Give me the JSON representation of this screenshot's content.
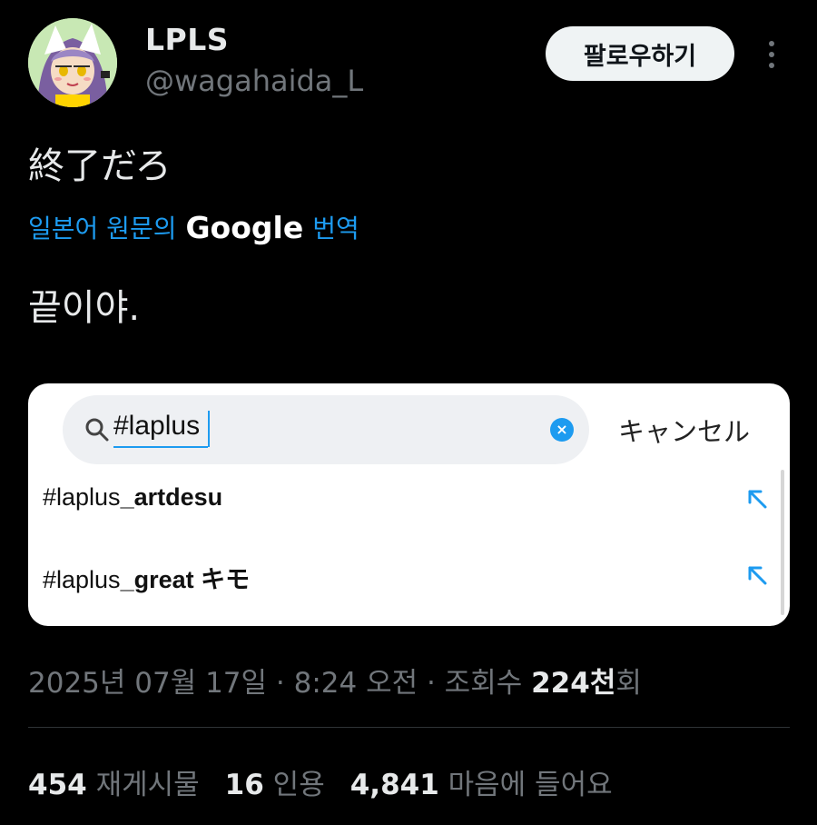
{
  "author": {
    "display_name": "LPLS",
    "handle": "@wagahaida_L"
  },
  "follow_button_label": "팔로우하기",
  "tweet": {
    "text": "終了だろ",
    "translation_prefix": "일본어 원문의",
    "translation_brand": "Google",
    "translation_suffix": "번역",
    "translated_text": "끝이야."
  },
  "embedded_image": {
    "search_query": "#laplus",
    "cancel_label": "キャンセル",
    "suggestions": [
      {
        "prefix": "#laplus",
        "suffix": "_artdesu"
      },
      {
        "prefix": "#laplus",
        "suffix": "_great キモ"
      }
    ]
  },
  "meta": {
    "timestamp": "2025년 07월 17일 · 8:24 오전 · 조회수",
    "views_count": "224천",
    "views_suffix": "회"
  },
  "stats": {
    "retweets_count": "454",
    "retweets_label": "재게시물",
    "quotes_count": "16",
    "quotes_label": "인용",
    "likes_count": "4,841",
    "likes_label": "마음에 들어요"
  },
  "colors": {
    "background": "#000000",
    "accent": "#1d9bf0",
    "secondary_text": "#71767b",
    "primary_text": "#e7e9ea"
  },
  "icons": {
    "more": "more-vertical-icon",
    "search": "search-icon",
    "clear": "clear-icon",
    "fill_arrow": "arrow-up-left-icon"
  }
}
